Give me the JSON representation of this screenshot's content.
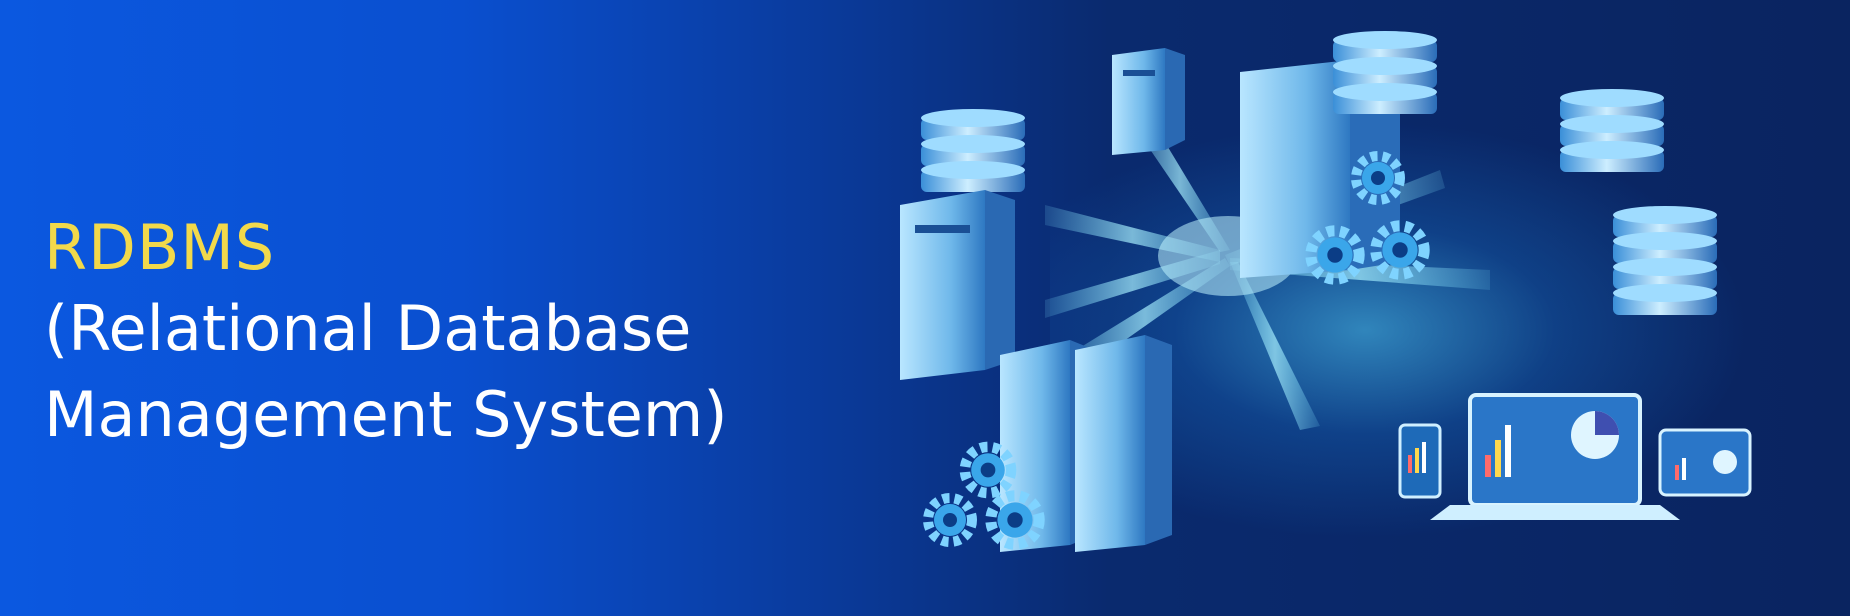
{
  "banner": {
    "title": "RDBMS",
    "subtitle_line1": "(Relational Database",
    "subtitle_line2": "Management System)"
  },
  "colors": {
    "title": "#f2d94b",
    "subtitle": "#ffffff",
    "background_left": "#0b58e0",
    "background_right": "#0a2460",
    "accent_cyan": "#5fd6ff"
  },
  "icons": [
    "database-stack-icon",
    "server-tower-icon",
    "gear-icon",
    "laptop-chart-icon",
    "phone-chart-icon",
    "tablet-chart-icon"
  ]
}
